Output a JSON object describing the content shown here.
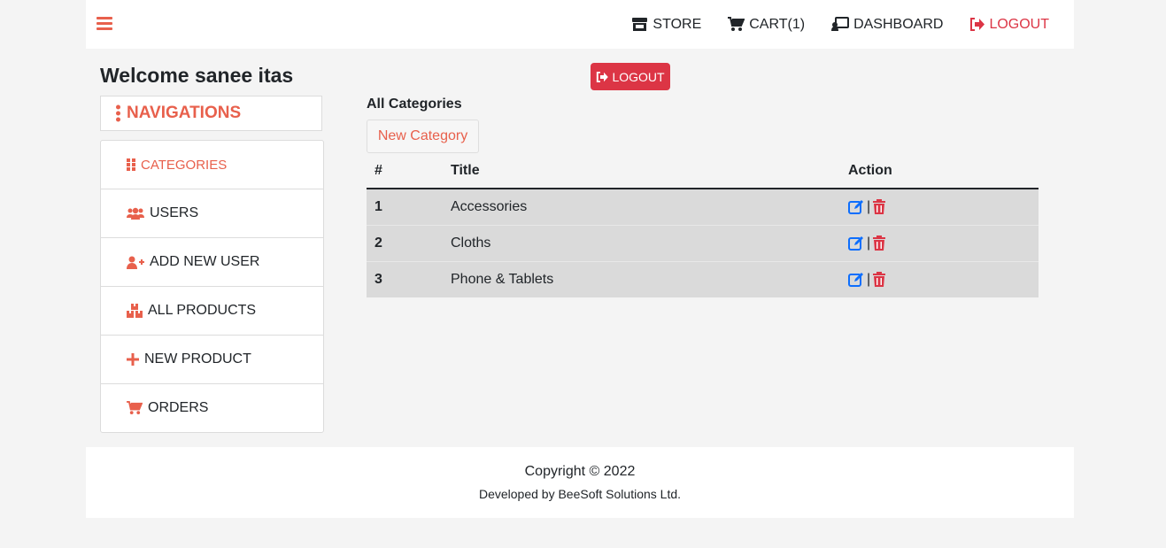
{
  "topnav": {
    "store": "STORE",
    "cart": "CART(1)",
    "dashboard": "DASHBOARD",
    "logout": "LOGOUT"
  },
  "welcome": "Welcome sanee itas",
  "logout_button": "LOGOUT",
  "sidebar": {
    "header": "NAVIGATIONS",
    "items": [
      {
        "label": "CATEGORIES",
        "icon": "grid-icon"
      },
      {
        "label": "USERS",
        "icon": "users-icon"
      },
      {
        "label": "ADD NEW USER",
        "icon": "user-plus-icon"
      },
      {
        "label": "ALL PRODUCTS",
        "icon": "boxes-icon"
      },
      {
        "label": "NEW PRODUCT",
        "icon": "plus-icon"
      },
      {
        "label": "ORDERS",
        "icon": "cart-icon"
      }
    ]
  },
  "main": {
    "section_title": "All Categories",
    "new_category_button": "New Category",
    "table": {
      "headers": [
        "#",
        "Title",
        "Action"
      ],
      "rows": [
        {
          "num": "1",
          "title": "Accessories"
        },
        {
          "num": "2",
          "title": "Cloths"
        },
        {
          "num": "3",
          "title": "Phone & Tablets"
        }
      ],
      "action_separator": "|"
    }
  },
  "footer": {
    "copyright": "Copyright © 2022",
    "developer": "Developed by BeeSoft Solutions Ltd."
  },
  "colors": {
    "accent": "#e8604c",
    "danger": "#dc3545",
    "edit": "#0d6efd"
  }
}
